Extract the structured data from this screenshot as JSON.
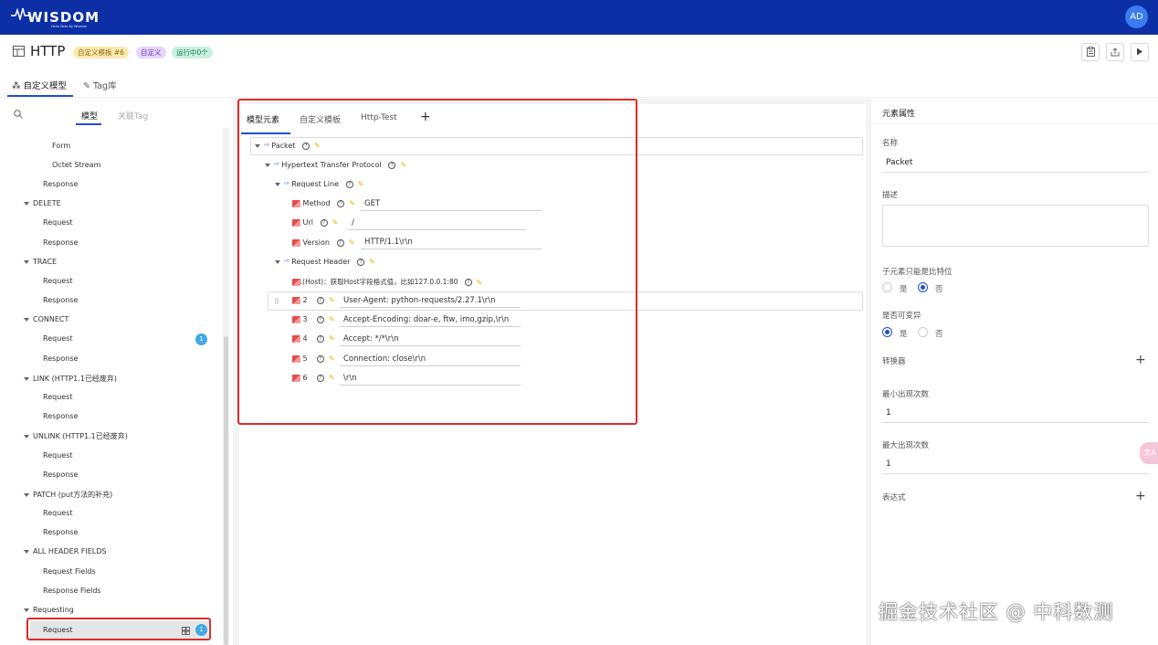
{
  "app": {
    "logo_text": "WISDOM",
    "logo_sub": "Hello Data By Wisdom",
    "user_initials": "AD"
  },
  "page": {
    "title": "HTTP",
    "badges": [
      "自定义模板 #6",
      "自定义",
      "运行中0个"
    ]
  },
  "toolbar": {
    "icons": [
      "clipboard-icon",
      "export-icon",
      "play-icon"
    ]
  },
  "top_tabs": [
    {
      "label": "自定义模型",
      "icon": "model-icon",
      "active": true
    },
    {
      "label": "Tag库",
      "icon": "pin-icon",
      "active": false
    }
  ],
  "left_panel": {
    "tabs": [
      {
        "label": "模型",
        "active": true
      },
      {
        "label": "关联Tag",
        "active": false
      }
    ],
    "tree": [
      {
        "label": "Form"
      },
      {
        "label": "Octet Stream"
      },
      {
        "label": "Response"
      },
      {
        "label": "DELETE"
      },
      {
        "label": "Request"
      },
      {
        "label": "Response"
      },
      {
        "label": "TRACE"
      },
      {
        "label": "Request"
      },
      {
        "label": "Response"
      },
      {
        "label": "CONNECT"
      },
      {
        "label": "Request",
        "badge": "1"
      },
      {
        "label": "Response"
      },
      {
        "label": "LINK (HTTP1.1已经废弃)"
      },
      {
        "label": "Request"
      },
      {
        "label": "Response"
      },
      {
        "label": "UNLINK (HTTP1.1已经废弃)"
      },
      {
        "label": "Request"
      },
      {
        "label": "Response"
      },
      {
        "label": "PATCH (put方法的补充)"
      },
      {
        "label": "Request"
      },
      {
        "label": "Response"
      },
      {
        "label": "ALL HEADER FIELDS"
      },
      {
        "label": "Request Fields"
      },
      {
        "label": "Response Fields"
      },
      {
        "label": "Requesting"
      },
      {
        "label": "Request",
        "badge": "1",
        "selected": true
      }
    ]
  },
  "middle_panel": {
    "tabs": [
      {
        "label": "模型元素",
        "active": true
      },
      {
        "label": "自定义模板",
        "active": false
      },
      {
        "label": "Http-Test",
        "active": false
      }
    ],
    "add_tab_label": "+",
    "nodes": {
      "packet": "Packet",
      "htp": "Hypertext Transfer Protocol",
      "request_line": "Request Line",
      "method": "Method",
      "method_value": "GET",
      "url": "Url",
      "url_value": "/",
      "version": "Version",
      "version_value": "HTTP/1.1\\r\\n",
      "request_header": "Request Header",
      "host_hint": "1(Host)：获取Host字段格式值，比如127.0.0.1:80",
      "fields": [
        {
          "index": "2",
          "value": "User-Agent: python-requests/2.27.1\\r\\n"
        },
        {
          "index": "3",
          "value": "Accept-Encoding: doar-e, ftw, imo,gzip,\\r\\n"
        },
        {
          "index": "4",
          "value": "Accept: */*\\r\\n"
        },
        {
          "index": "5",
          "value": "Connection: close\\r\\n"
        },
        {
          "index": "6",
          "value": "\\r\\n"
        }
      ],
      "drag_handle": "⠿"
    }
  },
  "right_panel": {
    "header": "元素属性",
    "name_label": "名称",
    "name_value": "Packet",
    "desc_label": "描述",
    "bit_label": "子元素只能是比特位",
    "bit_yes": "是",
    "bit_no": "否",
    "variable_label": "是否可变异",
    "variable_yes": "是",
    "variable_no": "否",
    "converter_label": "转换器",
    "min_label": "最小出现次数",
    "min_value": "1",
    "max_label": "最大出现次数",
    "max_value": "1",
    "expr_label": "表达式"
  },
  "float_button": "文A",
  "watermark": "掘金技术社区 @ 中科数测"
}
